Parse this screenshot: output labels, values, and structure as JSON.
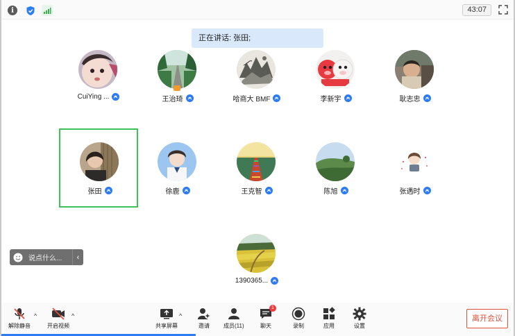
{
  "topbar": {
    "timer": "43:07"
  },
  "speaking": {
    "label": "正在讲话: 张田;"
  },
  "participants": [
    {
      "name": "CuiYing ...",
      "avatar": "baby-face"
    },
    {
      "name": "王治琦",
      "avatar": "forest-road",
      "host": true
    },
    {
      "name": "哈商大 BMF",
      "avatar": "ink-painting"
    },
    {
      "name": "李新宇",
      "avatar": "cartoon-pigs"
    },
    {
      "name": "耿志忠",
      "avatar": "child-portrait"
    },
    {
      "name": "张田",
      "avatar": "woman-portrait",
      "speaking": true
    },
    {
      "name": "徐鹿",
      "avatar": "boy-portrait"
    },
    {
      "name": "王克智",
      "avatar": "railway-sunset"
    },
    {
      "name": "陈旭",
      "avatar": "green-hill"
    },
    {
      "name": "张遇时",
      "avatar": "cartoon-girl"
    },
    {
      "name": "1390365...",
      "avatar": "flower-fields"
    }
  ],
  "chat": {
    "placeholder": "说点什么..."
  },
  "toolbar": {
    "unmute": "解除静音",
    "start_video": "开启视频",
    "share_screen": "共享屏幕",
    "invite": "邀请",
    "members": "成员(11)",
    "chat": "聊天",
    "chat_badge": "1",
    "record": "录制",
    "apps": "应用",
    "settings": "设置",
    "leave": "离开会议"
  },
  "colors": {
    "accent": "#2d7bf3",
    "speaking_border": "#3dc25b",
    "leave": "#e0503a"
  }
}
